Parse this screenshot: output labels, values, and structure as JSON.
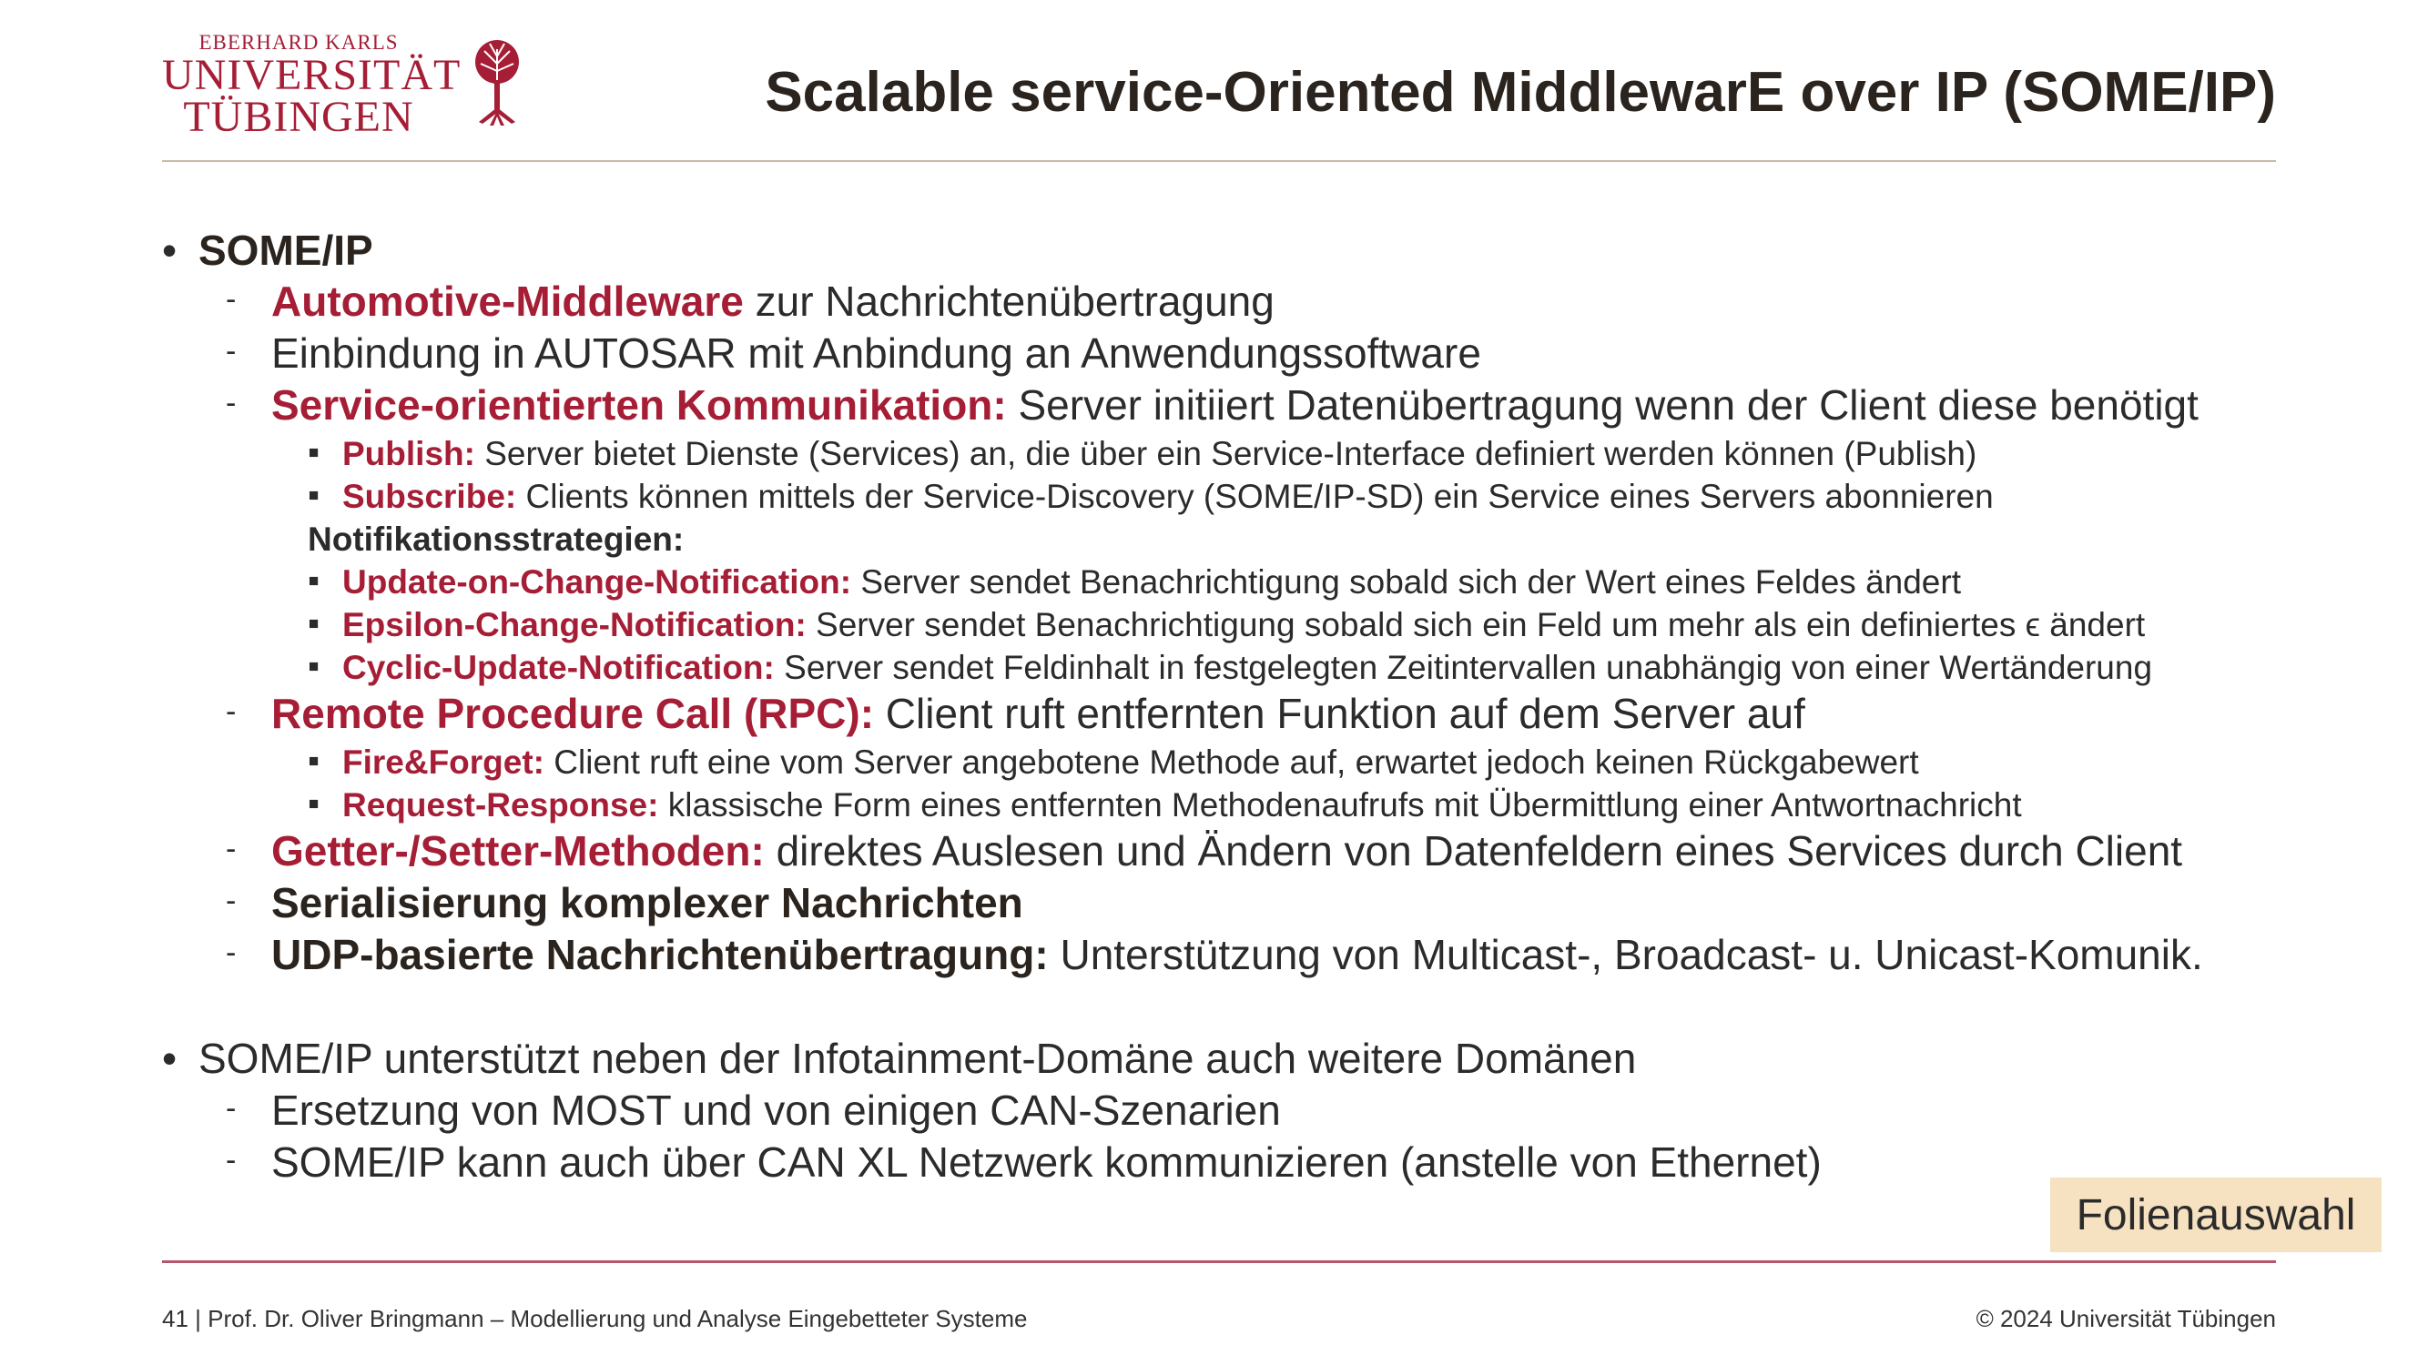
{
  "logo": {
    "line1": "EBERHARD KARLS",
    "line2": "UNIVERSITÄT",
    "line3": "TÜBINGEN",
    "color": "#a51e36"
  },
  "title": "Scalable service-Oriented MiddlewarE over IP (SOME/IP)",
  "bullets": {
    "b1": {
      "head": "SOME/IP"
    },
    "b1_1": {
      "hl": "Automotive-Middleware",
      "rest": " zur Nachrichtenübertragung"
    },
    "b1_2": {
      "rest": "Einbindung in AUTOSAR mit Anbindung an Anwendungssoftware"
    },
    "b1_3": {
      "hl": "Service-orientierten Kommunikation:",
      "rest": " Server initiiert Datenübertragung wenn der Client diese benötigt"
    },
    "b1_3_1": {
      "hl": "Publish:",
      "rest": " Server bietet Dienste (Services) an, die über ein Service-Interface definiert werden können (Publish)"
    },
    "b1_3_2": {
      "hl": "Subscribe:",
      "rest": " Clients können mittels der Service-Discovery (SOME/IP-SD) ein Service eines Servers abonnieren"
    },
    "notif_heading": "Notifikationsstrategien:",
    "b1_3_3": {
      "hl": "Update-on-Change-Notification:",
      "rest": " Server sendet Benachrichtigung sobald sich der Wert eines Feldes ändert"
    },
    "b1_3_4": {
      "hl": "Epsilon-Change-Notification:",
      "rest": " Server sendet Benachrichtigung sobald sich ein Feld um mehr als ein definiertes ϵ ändert"
    },
    "b1_3_5": {
      "hl": "Cyclic-Update-Notification:",
      "rest": " Server sendet Feldinhalt in festgelegten Zeitintervallen unabhängig von einer Wertänderung"
    },
    "b1_4": {
      "hl": "Remote Procedure Call (RPC):",
      "rest": " Client ruft entfernten Funktion auf dem Server auf"
    },
    "b1_4_1": {
      "hl": "Fire&Forget:",
      "rest": " Client ruft eine vom Server angebotene Methode auf, erwartet jedoch keinen Rückgabewert"
    },
    "b1_4_2": {
      "hl": "Request-Response:",
      "rest": " klassische Form eines entfernten Methodenaufrufs mit Übermittlung einer Antwortnachricht"
    },
    "b1_5": {
      "hl": "Getter-/Setter-Methoden:",
      "rest": " direktes Auslesen und Ändern von Datenfeldern eines Services durch Client"
    },
    "b1_6": {
      "bold": "Serialisierung komplexer Nachrichten"
    },
    "b1_7": {
      "bold": "UDP-basierte Nachrichtenübertragung:",
      "rest": " Unterstützung von Multicast-, Broadcast- u. Unicast-Komunik."
    },
    "b2": {
      "rest": "SOME/IP unterstützt neben der Infotainment-Domäne auch weitere Domänen"
    },
    "b2_1": {
      "rest": "Ersetzung von MOST und von einigen CAN-Szenarien"
    },
    "b2_2": {
      "rest": "SOME/IP kann auch über CAN XL Netzwerk kommunizieren (anstelle von Ethernet)"
    }
  },
  "markers": {
    "bullet": "•",
    "dash": "-",
    "square": "▪"
  },
  "button_label": "Folienauswahl",
  "footer": {
    "left": "41 | Prof. Dr. Oliver Bringmann – Modellierung und Analyse Eingebetteter Systeme",
    "right": "© 2024 Universität Tübingen"
  },
  "colors": {
    "accent": "#a51e36",
    "button_bg": "#f6e2c0",
    "rule_top": "#c9b9a4",
    "rule_bottom": "#b5566a"
  }
}
